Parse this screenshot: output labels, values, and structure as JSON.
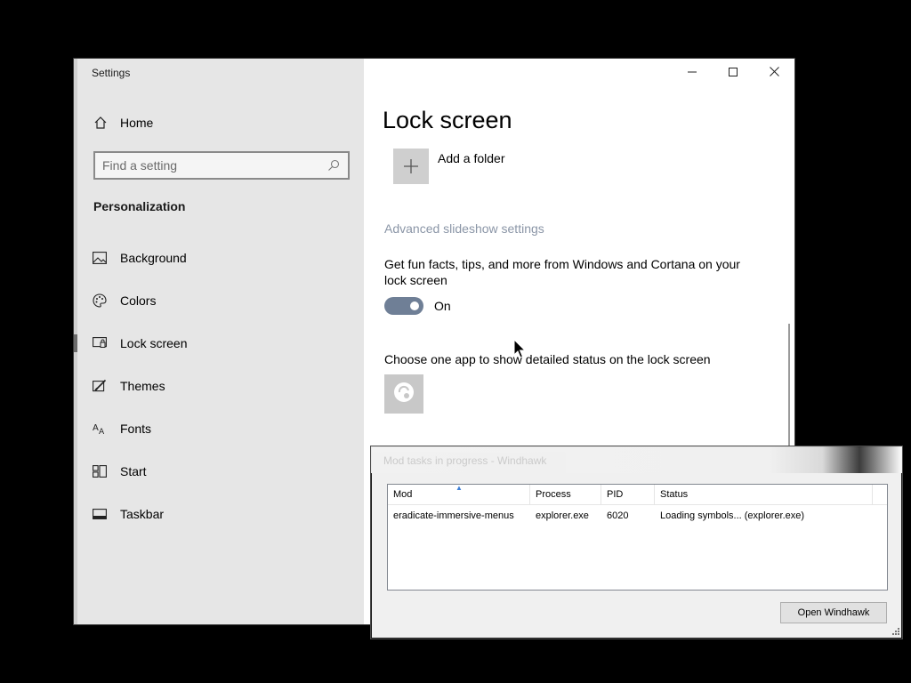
{
  "settings": {
    "app_title": "Settings",
    "sidebar": {
      "home_label": "Home",
      "search_placeholder": "Find a setting",
      "section_heading": "Personalization",
      "items": [
        {
          "label": "Background",
          "icon": "image-icon"
        },
        {
          "label": "Colors",
          "icon": "palette-icon"
        },
        {
          "label": "Lock screen",
          "icon": "lock-screen-icon",
          "selected": true
        },
        {
          "label": "Themes",
          "icon": "themes-brush-icon"
        },
        {
          "label": "Fonts",
          "icon": "fonts-icon"
        },
        {
          "label": "Start",
          "icon": "start-icon"
        },
        {
          "label": "Taskbar",
          "icon": "taskbar-icon"
        }
      ]
    },
    "content": {
      "page_title": "Lock screen",
      "add_folder_label": "Add a folder",
      "advanced_slideshow_link": "Advanced slideshow settings",
      "fun_facts_text": "Get fun facts, tips, and more from Windows and Cortana on your lock screen",
      "fun_facts_toggle_state": "On",
      "choose_app_text": "Choose one app to show detailed status on the lock screen"
    },
    "caption": {
      "minimize": "minimize-icon",
      "maximize": "maximize-icon",
      "close": "close-icon"
    }
  },
  "windhawk_dialog": {
    "title": "Mod tasks in progress - Windhawk",
    "columns": [
      "Mod",
      "Process",
      "PID",
      "Status"
    ],
    "rows": [
      {
        "mod": "eradicate-immersive-menus",
        "process": "explorer.exe",
        "pid": "6020",
        "status": "Loading symbols... (explorer.exe)"
      }
    ],
    "open_button_label": "Open Windhawk"
  },
  "colors": {
    "sidebar_bg": "#e6e6e6",
    "toggle_accent": "#6f7f96",
    "link_color": "#8a95a6"
  }
}
